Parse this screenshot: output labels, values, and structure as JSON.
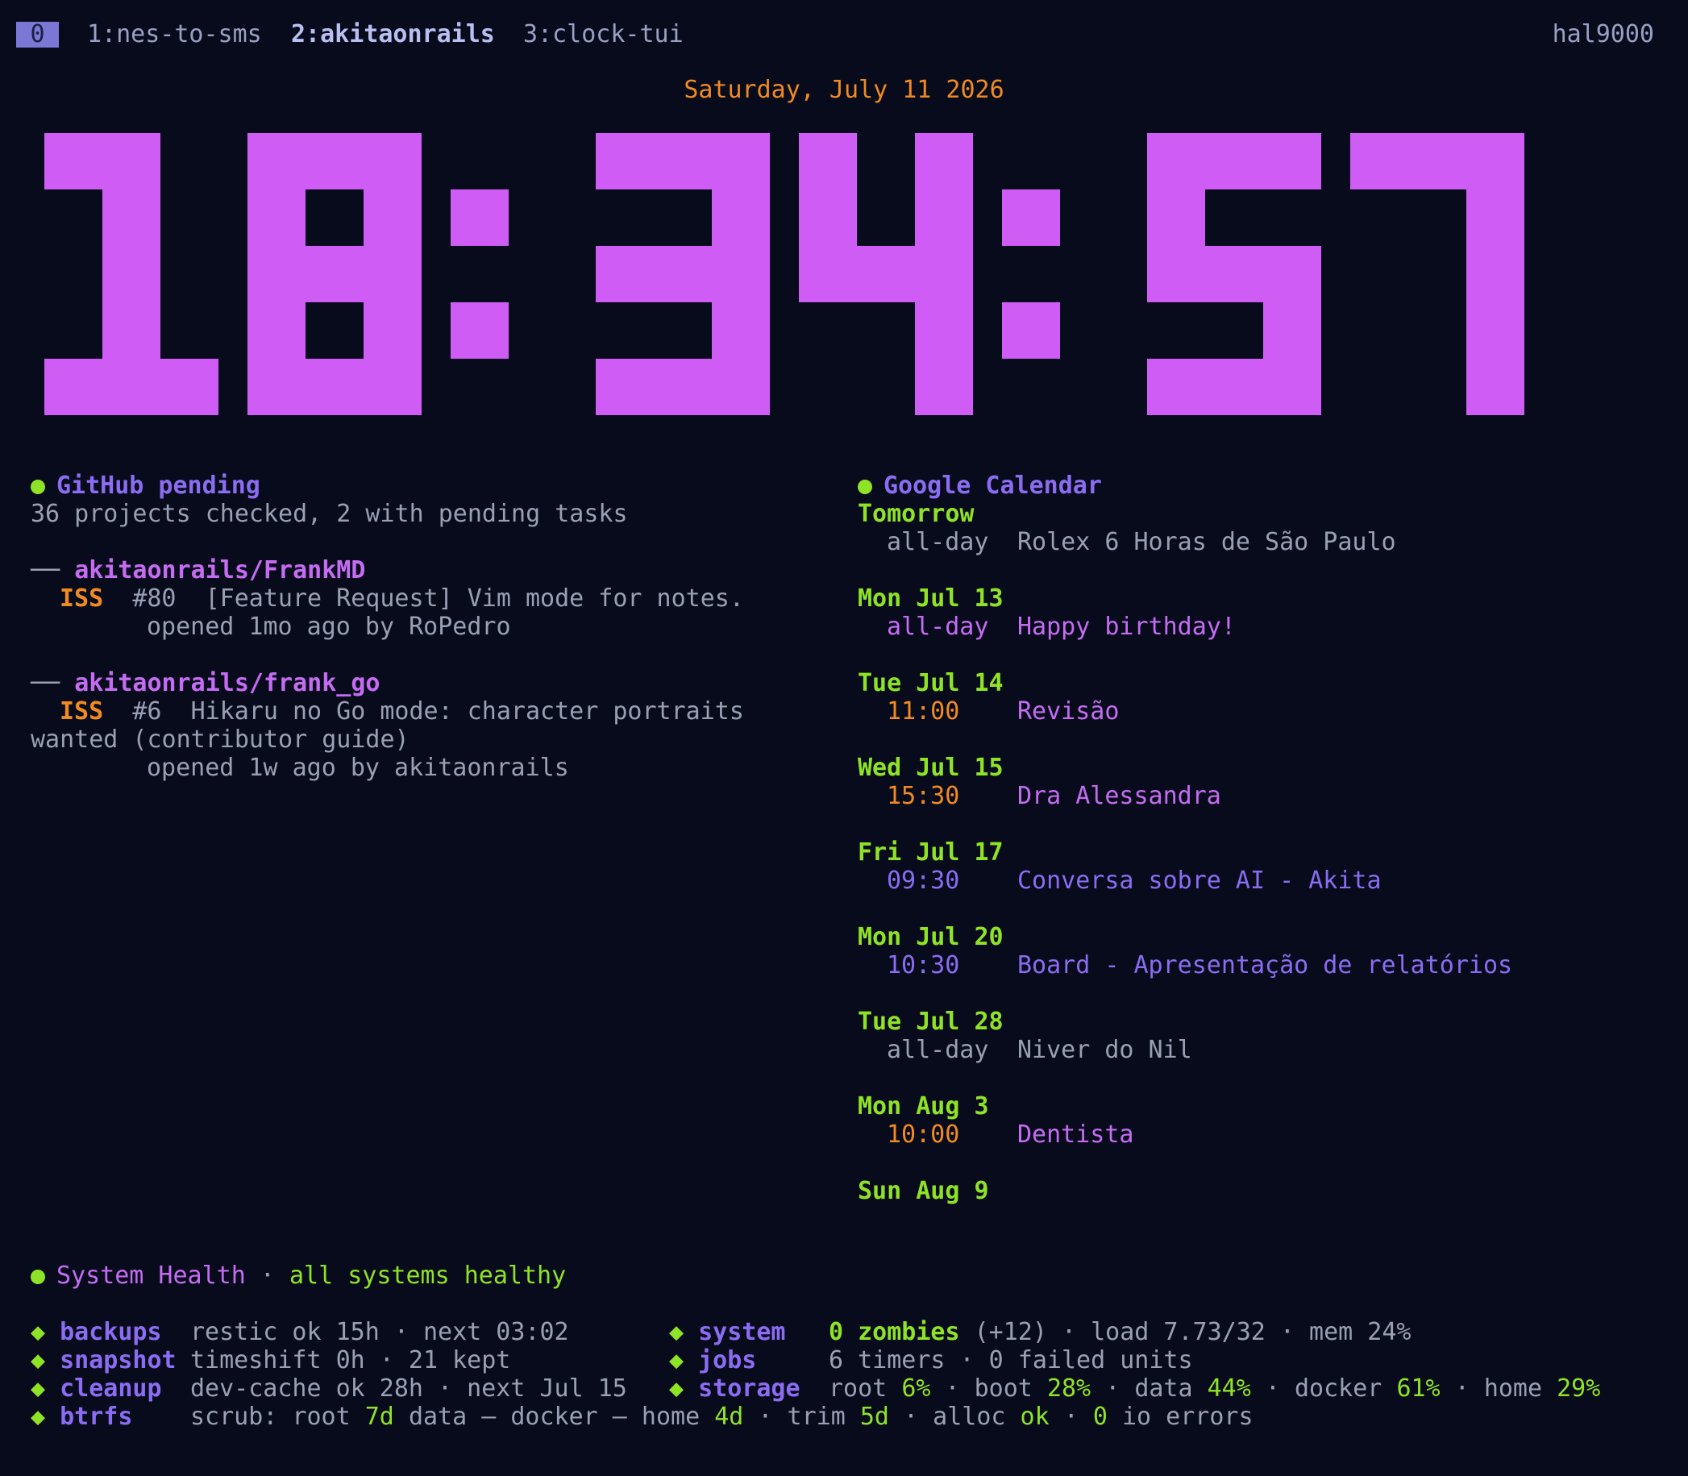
{
  "tmux": {
    "active_window": "0",
    "windows": [
      "1:nes-to-sms",
      "2:akitaonrails",
      "3:clock-tui"
    ],
    "hostname": "hal9000"
  },
  "date_line": "Saturday, July 11 2026",
  "clock": {
    "time": "18:34:57",
    "color": "#d05cf6"
  },
  "github": {
    "title": "GitHub pending",
    "summary": "36 projects checked, 2 with pending tasks",
    "repo_prefix": "──",
    "repos": [
      {
        "name": "akitaonrails/FrankMD",
        "kind": "ISS",
        "number": "#80",
        "title_line1": "[Feature Request] Vim mode for notes.",
        "title_line2": "",
        "meta": "opened 1mo ago by RoPedro"
      },
      {
        "name": "akitaonrails/frank_go",
        "kind": "ISS",
        "number": "#6",
        "title_line1": "Hikaru no Go mode: character portraits",
        "title_line2": "wanted (contributor guide)",
        "meta": "opened 1w ago by akitaonrails"
      }
    ]
  },
  "calendar": {
    "title": "Google Calendar",
    "days": [
      {
        "label": "Tomorrow",
        "time": "all-day",
        "event": "Rolex 6 Horas de São Paulo"
      },
      {
        "label": "Mon Jul 13",
        "time": "all-day",
        "event": "Happy birthday!"
      },
      {
        "label": "Tue Jul 14",
        "time": "11:00",
        "event": "Revisão"
      },
      {
        "label": "Wed Jul 15",
        "time": "15:30",
        "event": "Dra Alessandra"
      },
      {
        "label": "Fri Jul 17",
        "time": "09:30",
        "event": "Conversa sobre AI - Akita"
      },
      {
        "label": "Mon Jul 20",
        "time": "10:30",
        "event": "Board - Apresentação de relatórios"
      },
      {
        "label": "Tue Jul 28",
        "time": "all-day",
        "event": "Niver do Nil"
      },
      {
        "label": "Mon Aug 3",
        "time": "10:00",
        "event": "Dentista"
      },
      {
        "label": "Sun Aug 9",
        "time": "",
        "event": ""
      }
    ]
  },
  "health": {
    "title": "System Health",
    "separator": "·",
    "status": "all systems healthy",
    "bullet": "◆",
    "backups": {
      "label": "backups",
      "text": "restic ok 15h · next 03:02"
    },
    "snapshot": {
      "label": "snapshot",
      "text": "timeshift 0h · 21 kept"
    },
    "cleanup": {
      "label": "cleanup",
      "text": "dev-cache ok 28h · next Jul 15"
    },
    "btrfs": {
      "label": "btrfs",
      "scrub_prefix": "scrub: root",
      "root_age": "7d",
      "data_text": "data – docker – home",
      "home_age": "4d",
      "trim_text": "· trim",
      "trim_age": "5d",
      "alloc_text": "· alloc",
      "alloc_status": "ok",
      "io_sep": "·",
      "io_errors": "0",
      "io_text": "io errors"
    },
    "system": {
      "label": "system",
      "zombies": "0 zombies",
      "zombies_extra": "(+12)",
      "rest": "· load 7.73/32 · mem 24%"
    },
    "jobs": {
      "label": "jobs",
      "text": "6 timers · 0 failed units"
    },
    "storage": {
      "label": "storage",
      "items": [
        {
          "name": "root",
          "pct": "6%"
        },
        {
          "name": "boot",
          "pct": "28%"
        },
        {
          "name": "data",
          "pct": "44%"
        },
        {
          "name": "docker",
          "pct": "61%"
        },
        {
          "name": "home",
          "pct": "29%"
        }
      ]
    }
  },
  "colors": {
    "background": "#070b1c",
    "clock": "#d05cf6",
    "accent_green": "#8fe327",
    "accent_orange": "#f28a22",
    "accent_purple": "#c66cf2",
    "accent_violet": "#8b6cf2",
    "text_gray": "#9aa0b4"
  }
}
